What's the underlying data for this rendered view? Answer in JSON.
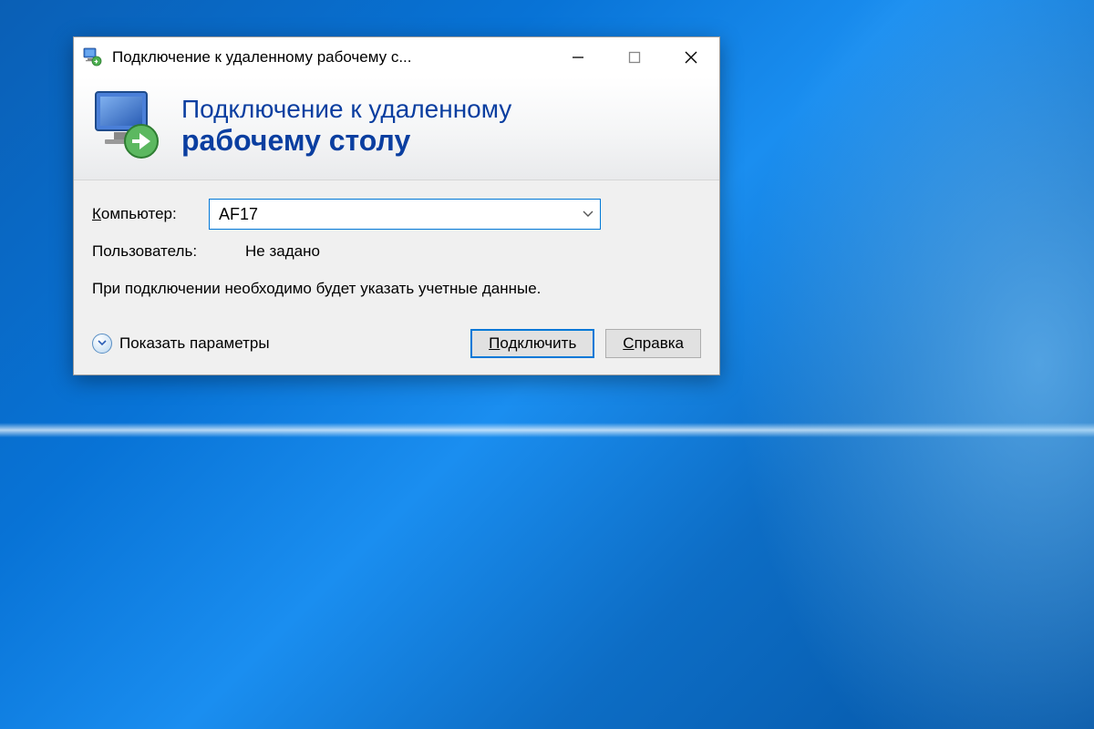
{
  "titlebar": {
    "title": "Подключение к удаленному рабочему с..."
  },
  "header": {
    "line1": "Подключение к удаленному",
    "line2": "рабочему столу"
  },
  "form": {
    "computer_label_prefix": "К",
    "computer_label_rest": "омпьютер:",
    "computer_value": "AF17",
    "user_label": "Пользователь:",
    "user_value": "Не задано",
    "info_text": "При подключении необходимо будет указать учетные данные."
  },
  "footer": {
    "show_params_prefix": "П",
    "show_params_rest": "оказать параметры",
    "connect_prefix": "П",
    "connect_rest": "одключить",
    "help_prefix": "С",
    "help_rest": "правка"
  }
}
